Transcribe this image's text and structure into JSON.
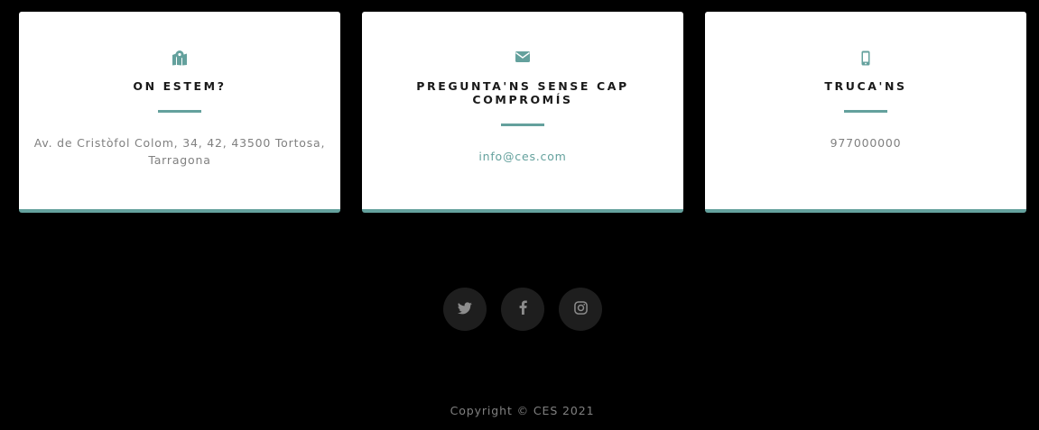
{
  "contact_cards": [
    {
      "icon": "map-marked-icon",
      "title": "On estem?",
      "text": "Av. de Cristòfol Colom, 34, 42, 43500 Tortosa, Tarragona"
    },
    {
      "icon": "envelope-icon",
      "title": "Pregunta'ns sense cap compromís",
      "text": "info@ces.com"
    },
    {
      "icon": "mobile-phone-icon",
      "title": "Truca'ns",
      "text": "977000000"
    }
  ],
  "social_links": [
    {
      "icon": "twitter-icon"
    },
    {
      "icon": "facebook-icon"
    },
    {
      "icon": "instagram-icon"
    }
  ],
  "footer": {
    "copyright": "Copyright © CES 2021"
  },
  "colors": {
    "accent": "#64a19d",
    "background": "#000000",
    "card": "#ffffff",
    "social_button": "#1e1e1e",
    "muted_text": "#808080"
  }
}
